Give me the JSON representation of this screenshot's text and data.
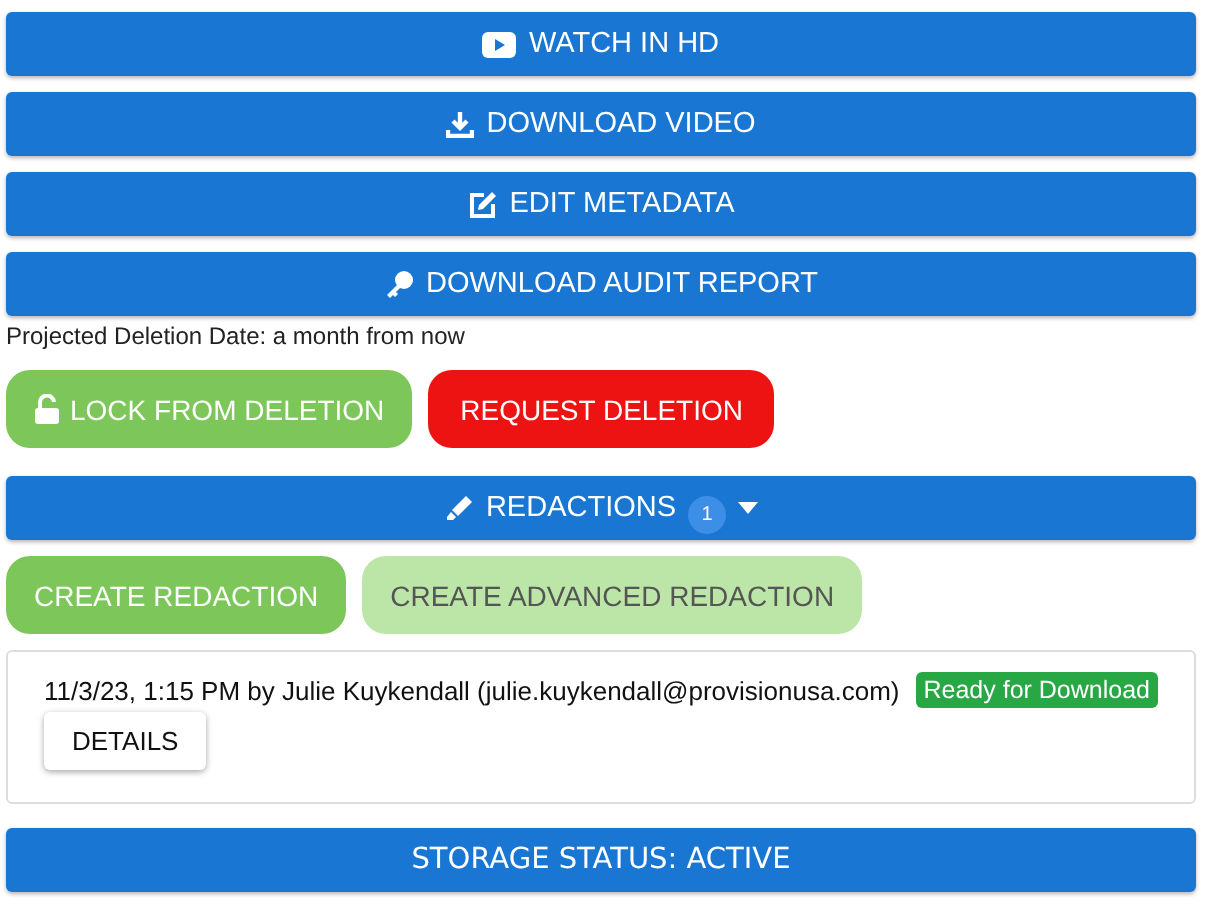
{
  "actions": [
    {
      "label": "WATCH IN HD",
      "kind": "video"
    },
    {
      "label": "DOWNLOAD VIDEO",
      "kind": "download"
    },
    {
      "label": "EDIT METADATA",
      "kind": "edit"
    },
    {
      "label": "DOWNLOAD AUDIT REPORT",
      "kind": "key"
    }
  ],
  "deletion_date": "Projected Deletion Date: a month from now",
  "deletion_buttons": [
    {
      "label": "LOCK FROM DELETION",
      "kind": "lock"
    },
    {
      "label": "REQUEST DELETION",
      "kind": "danger"
    }
  ],
  "redactions": {
    "label": "REDACTIONS",
    "count": "1",
    "expanded": true,
    "buttons": [
      {
        "label": "CREATE REDACTION",
        "disabled": false
      },
      {
        "label": "CREATE ADVANCED REDACTION",
        "disabled": true
      }
    ],
    "items": [
      {
        "text": "11/3/23, 1:15 PM by Julie Kuykendall (julie.kuykendall@provisionusa.com)",
        "status": "Ready for Download",
        "button": "DETAILS"
      }
    ]
  },
  "storage_status": "STORAGE STATUS: ACTIVE"
}
